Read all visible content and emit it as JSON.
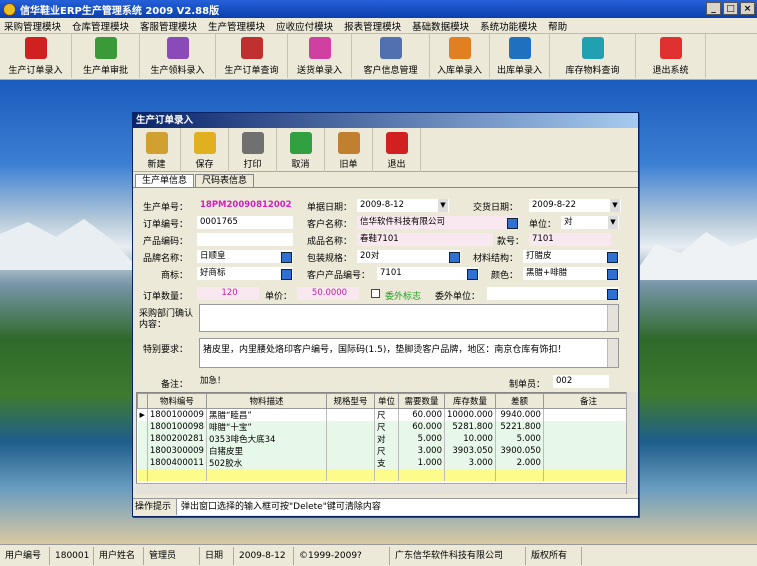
{
  "window": {
    "title": "信华鞋业ERP生产管理系统   2009 V2.88版"
  },
  "menu": [
    "采购管理模块",
    "仓库管理模块",
    "客服管理模块",
    "生产管理模块",
    "应收应付模块",
    "报表管理模块",
    "基础数据模块",
    "系统功能模块",
    "帮助"
  ],
  "toolbar": [
    {
      "label": "生产订单录入",
      "color": "#d02020"
    },
    {
      "label": "生产单审批",
      "color": "#3a9a3a"
    },
    {
      "label": "生产领料录入",
      "color": "#8a4ab8"
    },
    {
      "label": "生产订单查询",
      "color": "#c03030"
    },
    {
      "label": "送货单录入",
      "color": "#d040a0"
    },
    {
      "label": "客户信息管理",
      "color": "#5070b0"
    },
    {
      "label": "入库单录入",
      "color": "#e08020"
    },
    {
      "label": "出库单录入",
      "color": "#2070c0"
    },
    {
      "label": "库存物料查询",
      "color": "#20a0b0"
    },
    {
      "label": "退出系统",
      "color": "#e03030"
    }
  ],
  "dialog": {
    "title": "生产订单录入",
    "toolbar": [
      {
        "label": "新建",
        "color": "#d0a030"
      },
      {
        "label": "保存",
        "color": "#e0b020"
      },
      {
        "label": "打印",
        "color": "#707070"
      },
      {
        "label": "取消",
        "color": "#30a040"
      },
      {
        "label": "旧单",
        "color": "#c08030"
      },
      {
        "label": "退出",
        "color": "#d02020"
      }
    ],
    "tabs": [
      "生产单信息",
      "尺码表信息"
    ],
    "form": {
      "prod_no_label": "生产单号：",
      "prod_no": "18PM20090812002",
      "date_label": "单据日期：",
      "date": "2009-8-12",
      "delivery_label": "交货日期：",
      "delivery": "2009-8-22",
      "order_no_label": "订单编号：",
      "order_no": "0001765",
      "customer_label": "客户名称：",
      "customer": "信华软件科技有限公司",
      "unit_label": "单位：",
      "unit": "对",
      "product_code_label": "产品编码：",
      "product_code": "",
      "finished_label": "成品名称：",
      "finished": "春鞋7101",
      "style_label": "款号：",
      "style": "7101",
      "brand_label": "品牌名称：",
      "brand": "日顺皇",
      "pack_label": "包装规格：",
      "pack": "20对",
      "material_label": "材料结构：",
      "material": "打腊皮",
      "trademark_label": "商标：",
      "trademark": "好商标",
      "cust_prod_label": "客户产品编号：",
      "cust_prod": "7101",
      "color_label": "颜色：",
      "color": "黑腊+啡腊",
      "qty_label": "订单数量：",
      "qty": "120",
      "price_label": "单价：",
      "price": "50.0000",
      "outsource_label": "委外标志",
      "outsource_unit_label": "委外单位：",
      "outsource_unit": "",
      "purchase_label": "采购部门确认内容：",
      "purchase": "",
      "special_label": "特别要求：",
      "special": "猪皮里，内里腰处烙印客户编号，国际码(1.5)，垫脚烫客户品牌，地区：南京仓库有饰扣！",
      "remark_label": "备注：",
      "remark": "加急！",
      "maker_label": "制单员：",
      "maker": "002"
    },
    "grid": {
      "headers": [
        "物料编号",
        "物料描述",
        "规格型号",
        "单位",
        "需要数量",
        "库存数量",
        "差额",
        "备注"
      ],
      "rows": [
        [
          "1800100009",
          "黑腊“睦昌”",
          "",
          "尺",
          "60.000",
          "10000.000",
          "9940.000",
          ""
        ],
        [
          "1800100098",
          "啡腊“十宝”",
          "",
          "尺",
          "60.000",
          "5281.800",
          "5221.800",
          ""
        ],
        [
          "1800200281",
          "0353啡色大底34",
          "",
          "对",
          "5.000",
          "10.000",
          "5.000",
          ""
        ],
        [
          "1800300009",
          "白猪皮里",
          "",
          "尺",
          "3.000",
          "3903.050",
          "3900.050",
          ""
        ],
        [
          "1800400011",
          "502胶水",
          "",
          "支",
          "1.000",
          "3.000",
          "2.000",
          ""
        ]
      ]
    },
    "hint_label": "操作提示",
    "hint": "弹出窗口选择的输入框可按\"Delete\"键可清除内容"
  },
  "status": [
    "用户编号",
    "180001",
    "用户姓名",
    "管理员",
    "日期",
    "2009-8-12",
    "©1999-2009?",
    "广东信华软件科技有限公司",
    "版权所有"
  ]
}
